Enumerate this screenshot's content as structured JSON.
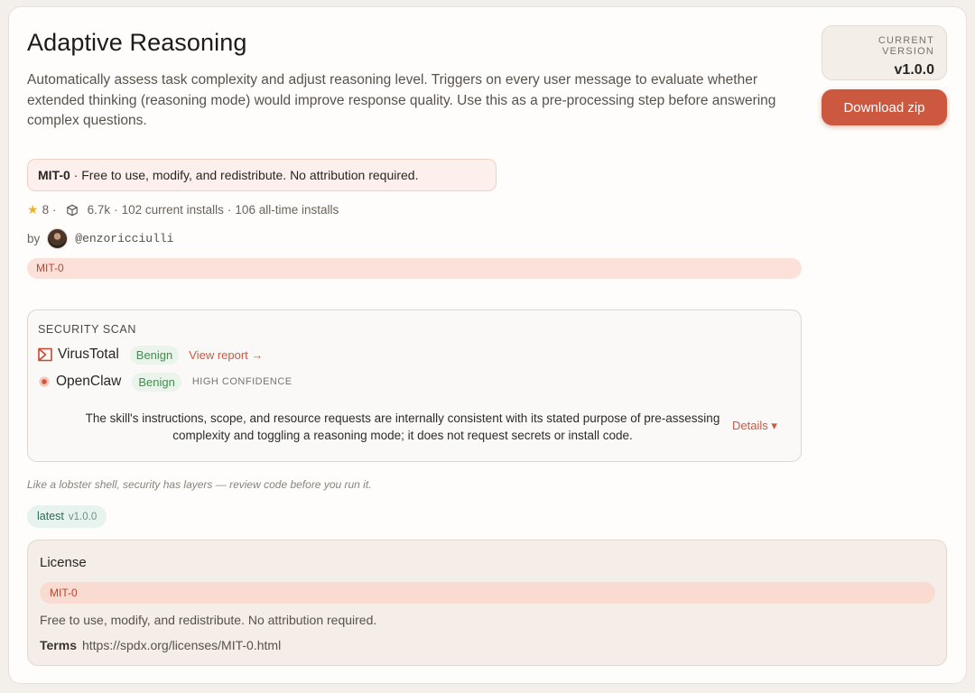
{
  "skill": {
    "title": "Adaptive Reasoning",
    "description": "Automatically assess task complexity and adjust reasoning level. Triggers on every user message to evaluate whether extended thinking (reasoning mode) would improve response quality. Use this as a pre-processing step before answering complex questions."
  },
  "version_box": {
    "label": "CURRENT VERSION",
    "value": "v1.0.0"
  },
  "download_label": "Download zip",
  "license_summary": {
    "name": "MIT-0",
    "text": " · Free to use, modify, and redistribute. No attribution required."
  },
  "stats": {
    "stars": "8",
    "downloads": "6.7k",
    "current_installs": "102 current installs",
    "all_time_installs": "106 all-time installs"
  },
  "author": {
    "by_label": "by",
    "handle": "@enzoricciulli"
  },
  "license_pill": "MIT-0",
  "security_scan": {
    "title": "SECURITY SCAN",
    "virustotal": {
      "name": "VirusTotal",
      "verdict": "Benign",
      "link": "View report →"
    },
    "openclaw": {
      "name": "OpenClaw",
      "verdict": "Benign",
      "confidence": "HIGH CONFIDENCE"
    },
    "summary": "The skill's instructions, scope, and resource requests are internally consistent with its stated purpose of pre-assessing complexity and toggling a reasoning mode; it does not request secrets or install code.",
    "details_label": "Details ▾"
  },
  "tagline": "Like a lobster shell, security has layers — review code before you run it.",
  "latest_tag": {
    "label": "latest",
    "version": "v1.0.0"
  },
  "license_section": {
    "heading": "License",
    "pill": "MIT-0",
    "text": "Free to use, modify, and redistribute. No attribution required.",
    "terms_label": "Terms",
    "terms_url": "https://spdx.org/licenses/MIT-0.html"
  },
  "colors": {
    "accent": "#cc5840",
    "benign": "#3f8f4a",
    "star": "#e9b52b"
  },
  "icons": {
    "star": "star-icon",
    "package": "package-icon",
    "virustotal": "virustotal-icon",
    "openclaw": "openclaw-icon"
  }
}
